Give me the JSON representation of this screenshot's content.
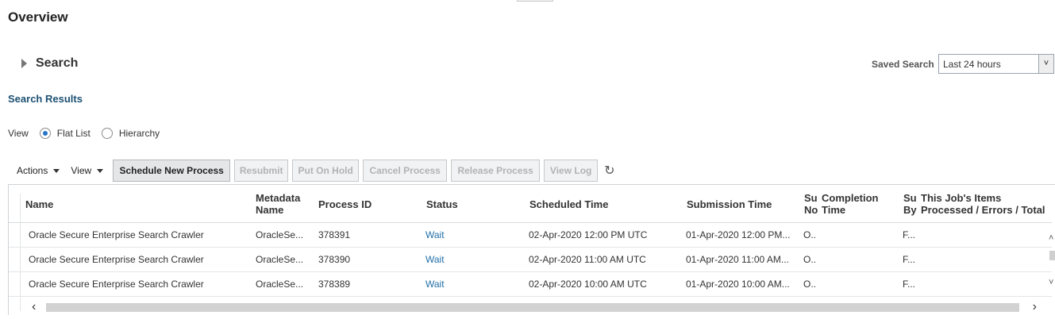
{
  "page": {
    "title": "Overview"
  },
  "search": {
    "label": "Search"
  },
  "saved_search": {
    "label": "Saved Search",
    "value": "Last 24 hours"
  },
  "results": {
    "title": "Search Results"
  },
  "view": {
    "label": "View",
    "options": [
      "Flat List",
      "Hierarchy"
    ],
    "selected": "Flat List"
  },
  "toolbar": {
    "actions": "Actions",
    "view": "View",
    "buttons": [
      "Schedule New Process",
      "Resubmit",
      "Put On Hold",
      "Cancel Process",
      "Release Process",
      "View Log"
    ],
    "refresh_icon": "refresh-icon"
  },
  "table": {
    "headers": {
      "name": "Name",
      "metadata_1": "Metadata",
      "metadata_2": "Name",
      "process_id": "Process ID",
      "status": "Status",
      "scheduled": "Scheduled Time",
      "submission": "Submission Time",
      "su_1": "Su",
      "su_2": "No",
      "completion_1": "Completion",
      "completion_2": "Time",
      "sub_1": "Su",
      "sub_2": "By",
      "items_1": "This Job's Items",
      "items_2": "Processed / Errors / Total"
    },
    "rows": [
      {
        "name": "Oracle Secure Enterprise Search Crawler",
        "meta": "OracleSe...",
        "pid": "378391",
        "status": "Wait",
        "scheduled": "02-Apr-2020 12:00 PM UTC",
        "submission": "01-Apr-2020 12:00 PM...",
        "su": "O..",
        "by": "F..."
      },
      {
        "name": "Oracle Secure Enterprise Search Crawler",
        "meta": "OracleSe...",
        "pid": "378390",
        "status": "Wait",
        "scheduled": "02-Apr-2020 11:00 AM UTC",
        "submission": "01-Apr-2020 11:00 AM...",
        "su": "O..",
        "by": "F..."
      },
      {
        "name": "Oracle Secure Enterprise Search Crawler",
        "meta": "OracleSe...",
        "pid": "378389",
        "status": "Wait",
        "scheduled": "02-Apr-2020 10:00 AM UTC",
        "submission": "01-Apr-2020 10:00 AM...",
        "su": "O..",
        "by": "F..."
      }
    ]
  },
  "colors": {
    "link": "#1f6fa8",
    "section_title": "#1c5072",
    "radio_selected": "#2775c7"
  }
}
